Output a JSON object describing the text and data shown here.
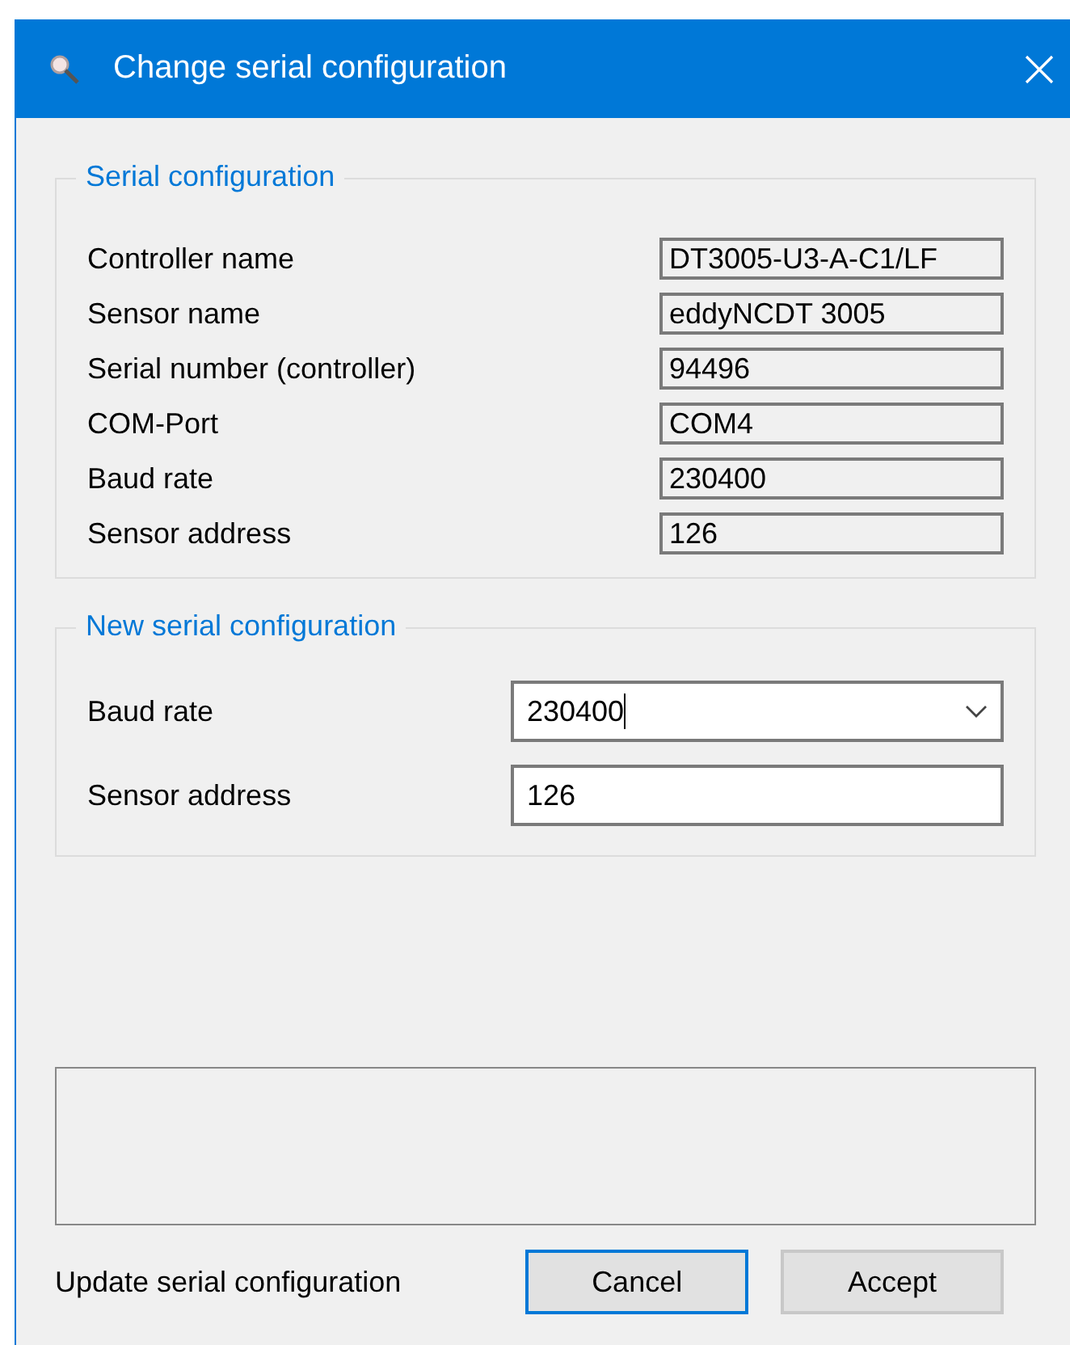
{
  "window": {
    "title": "Change serial configuration"
  },
  "current_config": {
    "title": "Serial configuration",
    "fields": [
      {
        "label": "Controller name",
        "value": "DT3005-U3-A-C1/LF"
      },
      {
        "label": "Sensor name",
        "value": "eddyNCDT 3005"
      },
      {
        "label": "Serial number (controller)",
        "value": "94496"
      },
      {
        "label": "COM-Port",
        "value": "COM4"
      },
      {
        "label": "Baud rate",
        "value": "230400"
      },
      {
        "label": "Sensor address",
        "value": "126"
      }
    ]
  },
  "new_config": {
    "title": "New serial configuration",
    "fields": [
      {
        "label": "Baud rate",
        "value": "230400",
        "kind": "dropdown",
        "focused": true
      },
      {
        "label": "Sensor address",
        "value": "126",
        "kind": "input",
        "focused": false
      }
    ]
  },
  "status_text": "Update serial configuration",
  "buttons": [
    {
      "label": "Cancel",
      "focused": true
    },
    {
      "label": "Accept",
      "focused": false
    }
  ]
}
